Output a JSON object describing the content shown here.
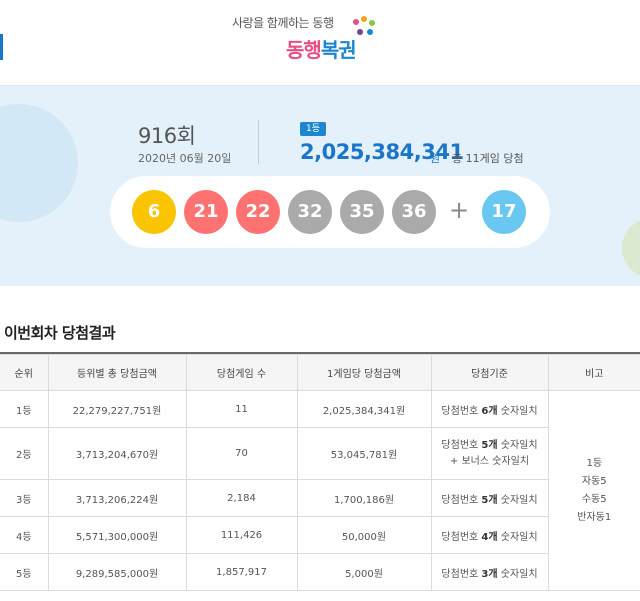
{
  "header": {
    "tagline": "사랑을 함께하는 동행",
    "brand_part1": "동행",
    "brand_part2": "복권"
  },
  "draw": {
    "round": "916회",
    "date": "2020년 06월 20일",
    "rank_badge": "1등",
    "first_prize": "2,025,384,341",
    "prize_unit": "원",
    "winners_note": "총 11게임 당첨",
    "numbers": [
      {
        "value": "6",
        "color": "#fbc400"
      },
      {
        "value": "21",
        "color": "#ff7272"
      },
      {
        "value": "22",
        "color": "#ff7272"
      },
      {
        "value": "32",
        "color": "#aaaaaa"
      },
      {
        "value": "35",
        "color": "#aaaaaa"
      },
      {
        "value": "36",
        "color": "#aaaaaa"
      }
    ],
    "plus": "+",
    "bonus": {
      "value": "17",
      "color": "#69c8f2"
    }
  },
  "section_title": "이번회차 당첨결과",
  "table": {
    "headers": [
      "순위",
      "등위별 총 당첨금액",
      "당첨게임 수",
      "1게임당 당첨금액",
      "당첨기준",
      "비고"
    ],
    "rows": [
      {
        "rank": "1등",
        "total": "22,279,227,751원",
        "games": "11",
        "per_game": "2,025,384,341원",
        "crit_pre": "당첨번호 ",
        "crit_bold": "6개",
        "crit_post": " 숫자일치",
        "crit_line2": ""
      },
      {
        "rank": "2등",
        "total": "3,713,204,670원",
        "games": "70",
        "per_game": "53,045,781원",
        "crit_pre": "당첨번호 ",
        "crit_bold": "5개",
        "crit_post": " 숫자일치",
        "crit_line2": "+ 보너스 숫자일치"
      },
      {
        "rank": "3등",
        "total": "3,713,206,224원",
        "games": "2,184",
        "per_game": "1,700,186원",
        "crit_pre": "당첨번호 ",
        "crit_bold": "5개",
        "crit_post": " 숫자일치",
        "crit_line2": ""
      },
      {
        "rank": "4등",
        "total": "5,571,300,000원",
        "games": "111,426",
        "per_game": "50,000원",
        "crit_pre": "당첨번호 ",
        "crit_bold": "4개",
        "crit_post": " 숫자일치",
        "crit_line2": ""
      },
      {
        "rank": "5등",
        "total": "9,289,585,000원",
        "games": "1,857,917",
        "per_game": "5,000원",
        "crit_pre": "당첨번호 ",
        "crit_bold": "3개",
        "crit_post": " 숫자일치",
        "crit_line2": ""
      }
    ],
    "remarks": [
      "1등",
      "자동5",
      "수동5",
      "반자동1"
    ]
  }
}
